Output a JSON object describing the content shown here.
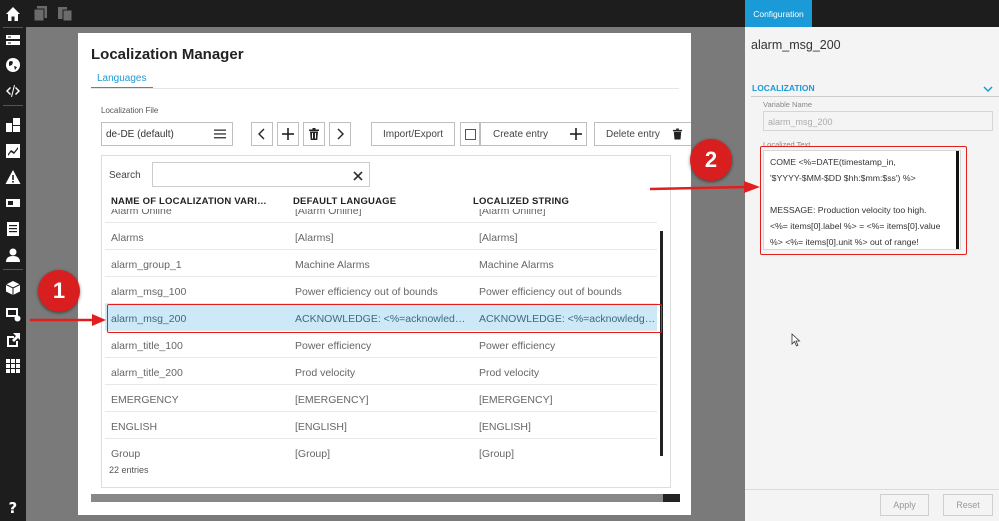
{
  "top_toolbar": {
    "icons": [
      "copy-icon",
      "paste-icon"
    ]
  },
  "left_nav": {
    "icons": [
      "home-icon",
      "screens-icon",
      "globe-icon",
      "code-icon",
      "widgets-icon",
      "chart-icon",
      "alarm-icon",
      "device-icon",
      "list-icon",
      "user-icon",
      "package-icon",
      "remote-icon",
      "export-icon",
      "grid-icon",
      "help-icon"
    ]
  },
  "localization_manager": {
    "title": "Localization Manager",
    "tab_languages": "Languages",
    "file_label": "Localization File",
    "file_value": "de-DE (default)",
    "import_export_label": "Import/Export",
    "create_entry_label": "Create entry",
    "delete_entry_label": "Delete entry",
    "search_label": "Search",
    "search_value": "",
    "columns": [
      "NAME OF LOCALIZATION VARI…",
      "DEFAULT LANGUAGE",
      "LOCALIZED STRING"
    ],
    "rows": [
      {
        "name": "Alarm Online",
        "default": "[Alarm Online]",
        "localized": "[Alarm Online]"
      },
      {
        "name": "Alarms",
        "default": "[Alarms]",
        "localized": "[Alarms]"
      },
      {
        "name": "alarm_group_1",
        "default": "Machine Alarms",
        "localized": "Machine Alarms"
      },
      {
        "name": "alarm_msg_100",
        "default": "Power efficiency out of bounds",
        "localized": "Power efficiency out of bounds"
      },
      {
        "name": "alarm_msg_200",
        "default": "ACKNOWLEDGE: <%=acknowledgeab…",
        "localized": "ACKNOWLEDGE: <%=acknowledgeab…"
      },
      {
        "name": "alarm_title_100",
        "default": "Power efficiency",
        "localized": "Power efficiency"
      },
      {
        "name": "alarm_title_200",
        "default": "Prod velocity",
        "localized": "Prod velocity"
      },
      {
        "name": "EMERGENCY",
        "default": "[EMERGENCY]",
        "localized": "[EMERGENCY]"
      },
      {
        "name": "ENGLISH",
        "default": "[ENGLISH]",
        "localized": "[ENGLISH]"
      },
      {
        "name": "Group",
        "default": "[Group]",
        "localized": "[Group]"
      }
    ],
    "selected_row": "alarm_msg_200",
    "entries_count": "22 entries"
  },
  "config_panel": {
    "tab": "Configuration",
    "title": "alarm_msg_200",
    "section": "LOCALIZATION",
    "variable_name_label": "Variable Name",
    "variable_name_value": "alarm_msg_200",
    "localized_text_label": "Localized Text",
    "localized_text": "COME <%=DATE(timestamp_in,\n'$YYYY-$MM-$DD $hh:$mm:$ss') %>\n\nMESSAGE: Production velocity too high.\n<%= items[0].label %> = <%= items[0].value\n%> <%= items[0].unit %> out of range!",
    "apply_label": "Apply",
    "reset_label": "Reset"
  },
  "annotations": {
    "badge_1": "1",
    "badge_2": "2",
    "color": "#e21f1f"
  }
}
